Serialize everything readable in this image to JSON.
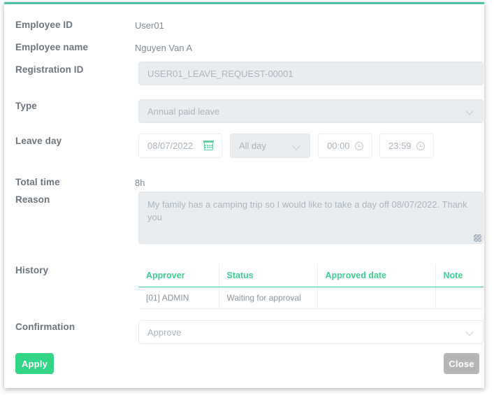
{
  "modal": {
    "accent_color": "#4dbfa4"
  },
  "fields": {
    "employee_id": {
      "label": "Employee ID",
      "value": "User01"
    },
    "employee_name": {
      "label": "Employee name",
      "value": "Nguyen Van A"
    },
    "registration_id": {
      "label": "Registration ID",
      "value": "USER01_LEAVE_REQUEST-00001"
    },
    "type": {
      "label": "Type",
      "value": "Annual paid leave",
      "icon": "chevron-down-icon"
    },
    "leave_day": {
      "label": "Leave day",
      "date": "08/07/2022",
      "date_icon": "calendar-icon",
      "duration": "All day",
      "duration_icon": "chevron-down-icon",
      "time_from": "00:00",
      "time_to": "23:59",
      "time_icon": "clock-icon"
    },
    "total_time": {
      "label": "Total time",
      "value": "8h"
    },
    "reason": {
      "label": "Reason",
      "value": "My family has a camping trip so I would like to take a day off 08/07/2022. Thank you"
    },
    "history": {
      "label": "History"
    },
    "confirmation": {
      "label": "Confirmation",
      "value": "Approve",
      "icon": "chevron-down-icon"
    }
  },
  "history_table": {
    "columns": [
      "Approver",
      "Status",
      "Approved date",
      "Note"
    ],
    "rows": [
      {
        "approver": "[01] ADMIN",
        "status": "Waiting for approval",
        "approved_date": "",
        "note": ""
      }
    ]
  },
  "footer": {
    "apply_label": "Apply",
    "apply_color": "#32d486",
    "close_label": "Close",
    "close_color": "#b5b5b5"
  }
}
